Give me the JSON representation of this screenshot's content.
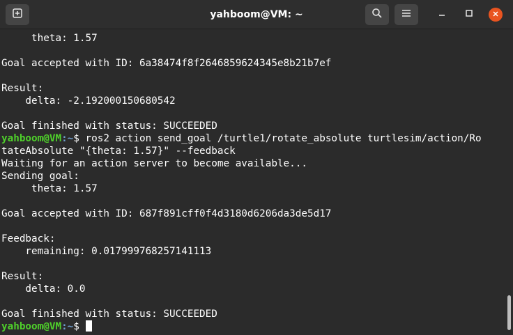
{
  "window": {
    "title": "yahboom@VM: ~"
  },
  "icons": {
    "new_tab": "new-tab-icon",
    "search": "search-icon",
    "menu": "hamburger-menu-icon",
    "minimize": "minimize-icon",
    "maximize": "maximize-icon",
    "close": "close-icon"
  },
  "colors": {
    "background": "#2b2b2b",
    "titlebar": "#2e2e2e",
    "text": "#ffffff",
    "prompt_user": "#4fd12b",
    "prompt_path": "#6f9ecf",
    "close_button": "#e95420"
  },
  "terminal": {
    "lines": [
      "     theta: 1.57",
      "",
      "Goal accepted with ID: 6a38474f8f2646859624345e8b21b7ef",
      "",
      "Result:",
      "    delta: -2.192000150680542",
      "",
      "Goal finished with status: SUCCEEDED"
    ],
    "prompt_user": "yahboom@VM",
    "prompt_path": ":~",
    "prompt_symbol": "$ ",
    "command_1": "ros2 action send_goal /turtle1/rotate_absolute turtlesim/action/Ro",
    "command_1_wrap": "tateAbsolute \"{theta: 1.57}\" --feedback",
    "output_lines": [
      "Waiting for an action server to become available...",
      "Sending goal:",
      "     theta: 1.57",
      "",
      "Goal accepted with ID: 687f891cff0f4d3180d6206da3de5d17",
      "",
      "Feedback:",
      "    remaining: 0.017999768257141113",
      "",
      "Result:",
      "    delta: 0.0",
      "",
      "Goal finished with status: SUCCEEDED"
    ]
  }
}
